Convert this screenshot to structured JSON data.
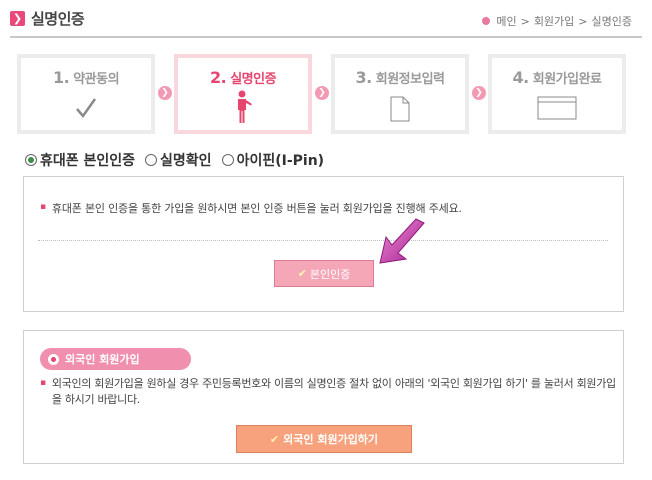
{
  "header": {
    "title": "실명인증",
    "title_icon": "chevron-right-icon",
    "breadcrumb": [
      "메인",
      "회원가입",
      "실명인증"
    ],
    "breadcrumb_sep": ">"
  },
  "steps": [
    {
      "num": "1.",
      "label": "약관동의",
      "icon": "check-icon",
      "active": false
    },
    {
      "num": "2.",
      "label": "실명인증",
      "icon": "person-icon",
      "active": true
    },
    {
      "num": "3.",
      "label": "회원정보입력",
      "icon": "document-icon",
      "active": false
    },
    {
      "num": "4.",
      "label": "회원가입완료",
      "icon": "window-icon",
      "active": false
    }
  ],
  "auth_options": {
    "selected": "휴대폰 본인인증",
    "items": [
      "휴대폰 본인인증",
      "실명확인",
      "아이핀(I-Pin)"
    ]
  },
  "phone_auth": {
    "message": "휴대폰 본인 인증을 통한 가입을 원하시면 본인 인증 버튼을 눌러 회원가입을 진행해 주세요.",
    "button_label": "본인인증"
  },
  "foreign": {
    "badge_label": "외국인 회원가입",
    "message": "외국인의 회원가입을 원하실 경우 주민등록번호와 이름의 실명인증 절차 없이 아래의 '외국인 회원가입 하기' 를 눌러서 회원가입을 하시기 바랍니다.",
    "button_label": "외국인 회원가입하기"
  },
  "colors": {
    "accent": "#e5466e",
    "step_active_border": "#f8d7dd",
    "verify_button": "#f5a7b8",
    "foreign_button": "#f7a27c",
    "badge": "#f08fae"
  }
}
